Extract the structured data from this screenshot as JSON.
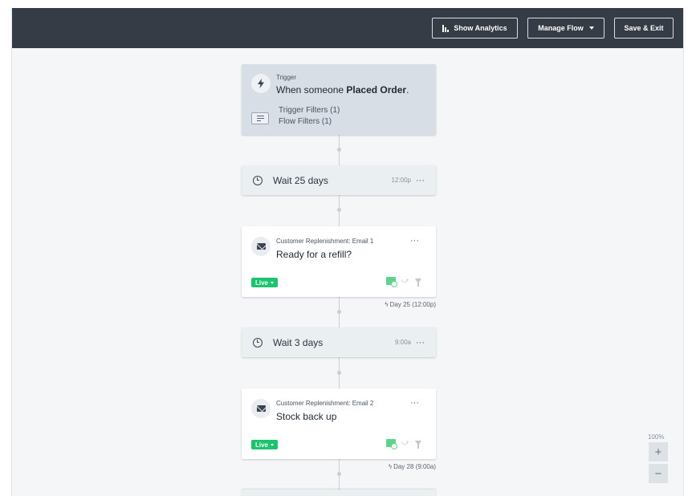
{
  "toolbar": {
    "analytics_label": "Show Analytics",
    "manage_label": "Manage Flow",
    "save_label": "Save & Exit"
  },
  "trigger": {
    "eyebrow": "Trigger",
    "headline_prefix": "When someone ",
    "headline_event": "Placed Order",
    "headline_suffix": ".",
    "trigger_filters": "Trigger Filters (1)",
    "flow_filters": "Flow Filters (1)",
    "icon": "bolt-icon"
  },
  "steps": {
    "wait1": {
      "label": "Wait 25 days",
      "time": "12:00p",
      "more": "···"
    },
    "email1": {
      "eyebrow": "Customer Replenishment: Email 1",
      "subject": "Ready for a refill?",
      "status": "Live",
      "more": "···",
      "day_note": "Day 25 (12:00p)"
    },
    "wait2": {
      "label": "Wait 3 days",
      "time": "9:00a",
      "more": "···"
    },
    "email2": {
      "eyebrow": "Customer Replenishment: Email 2",
      "subject": "Stock back up",
      "status": "Live",
      "more": "···",
      "day_note": "Day 28 (9:00a)"
    }
  },
  "zoom": {
    "level": "100%",
    "plus": "+",
    "minus": "−"
  },
  "colors": {
    "topbar": "#353c45",
    "live": "#1cc46f",
    "trigger_card": "#d7dee6",
    "wait_card": "#eaeff1"
  }
}
